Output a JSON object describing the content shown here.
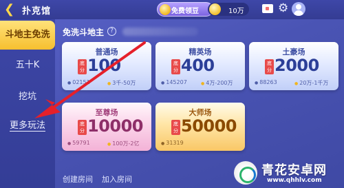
{
  "header": {
    "title": "扑克馆",
    "free_bean_label": "免费领豆",
    "balance": "10万"
  },
  "sidebar": {
    "items": [
      {
        "label": "斗地主免洗",
        "active": true
      },
      {
        "label": "五十K"
      },
      {
        "label": "挖坑"
      },
      {
        "label": "更多玩法"
      }
    ]
  },
  "main": {
    "section_title": "免洗斗地主",
    "rooms": [
      {
        "name": "普通场",
        "badge": "底分",
        "base_score": "100",
        "online": "02151",
        "range": "3千-50万"
      },
      {
        "name": "精英场",
        "badge": "底分",
        "base_score": "400",
        "online": "145207",
        "range": "4万-200万"
      },
      {
        "name": "土豪场",
        "badge": "底分",
        "base_score": "2000",
        "online": "88263",
        "range": "20万-1千万"
      },
      {
        "name": "至尊场",
        "badge": "底分",
        "base_score": "10000",
        "online": "59791",
        "range": "100万-2亿"
      },
      {
        "name": "大师场",
        "badge": "底分",
        "base_score": "50000",
        "online": "31319",
        "range": ""
      }
    ],
    "create_room": "创建房间",
    "join_room": "加入房间"
  },
  "watermark": {
    "name": "青花安卓网",
    "url": "www.qhhlv.com"
  },
  "colors": {
    "active_tab": "#f6bf2f",
    "arrow": "#e5202a"
  }
}
